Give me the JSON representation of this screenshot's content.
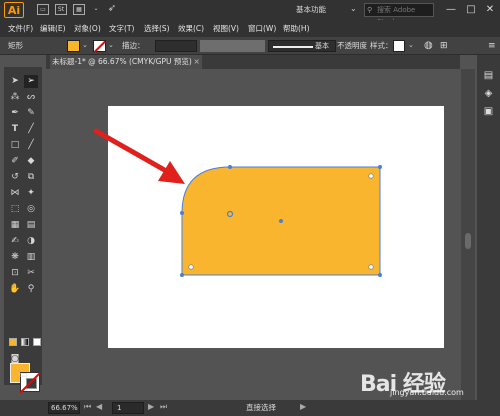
{
  "app": {
    "logo": "Ai"
  },
  "titlebar": {
    "icons": [
      "ai-logo",
      "br",
      "st",
      "layout"
    ],
    "workspace": "基本功能",
    "search_placeholder": "搜索 Adobe Stock",
    "window_buttons": [
      "—",
      "□",
      "✕"
    ]
  },
  "menu": [
    "文件(F)",
    "编辑(E)",
    "对象(O)",
    "文字(T)",
    "选择(S)",
    "效果(C)",
    "视图(V)",
    "窗口(W)",
    "帮助(H)"
  ],
  "controlbar": {
    "tool_name": "矩形",
    "stroke_label": "描边：",
    "stroke_profile": "基本",
    "opacity_label": "不透明度",
    "style_label": "样式：",
    "colors": {
      "fill": "#f9b52e",
      "stroke": "none"
    }
  },
  "document": {
    "tab_title": "未标题-1* @ 66.67% (CMYK/GPU 预览)",
    "close_glyph": "×"
  },
  "statusbar": {
    "zoom": "66.67%",
    "artboard_num": "1",
    "tool_hint": "直接选择"
  },
  "shape": {
    "fill": "#f9b52e",
    "stroke": "#4a7fd6"
  },
  "annotation": {
    "arrow_color": "#e0201c"
  },
  "watermark": {
    "main": "Bai 经验",
    "sub": "jingyan.baidu.com"
  }
}
